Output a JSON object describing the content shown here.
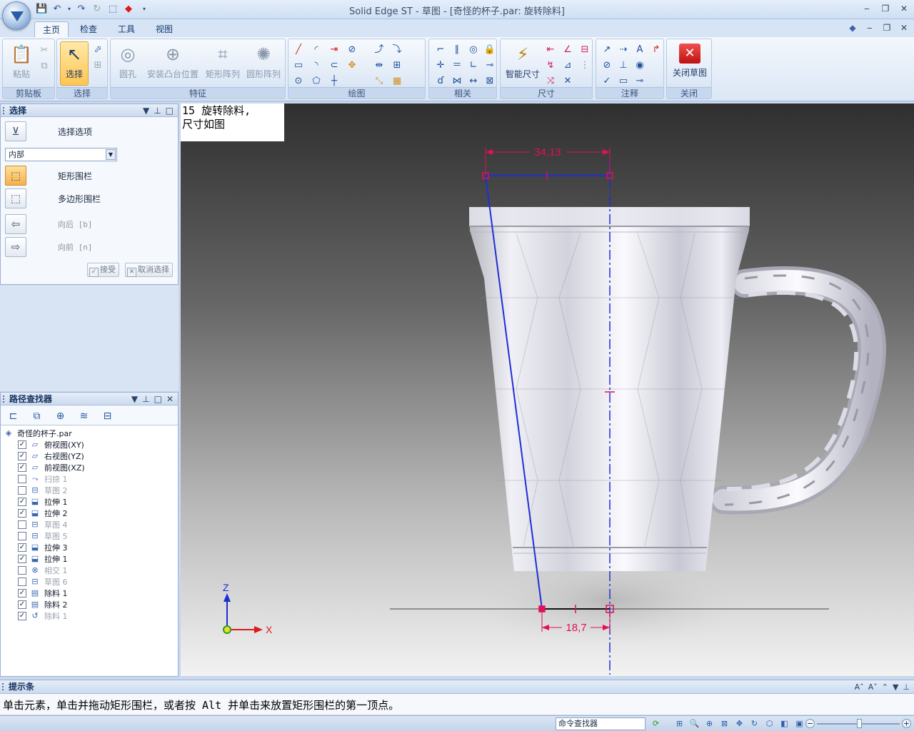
{
  "window": {
    "title": "Solid Edge ST - 草图 - [奇怪的杯子.par: 旋转除料]"
  },
  "tabs": [
    {
      "label": "主页",
      "active": true
    },
    {
      "label": "检查",
      "active": false
    },
    {
      "label": "工具",
      "active": false
    },
    {
      "label": "视图",
      "active": false
    }
  ],
  "ribbon": {
    "groups": {
      "clipboard": "剪贴板",
      "select": "选择",
      "feature": "特征",
      "draw": "绘图",
      "relate": "相关",
      "dimension": "尺寸",
      "annotation": "注释",
      "close": "关闭"
    },
    "buttons": {
      "paste": "粘贴",
      "select": "选择",
      "hole": "圆孔",
      "boss": "安装凸台位置",
      "rect_pattern": "矩形阵列",
      "circ_pattern": "圆形阵列",
      "smart_dim": "智能尺寸",
      "close_sketch": "关闭草图"
    }
  },
  "select_panel": {
    "title": "选择",
    "options_label": "选择选项",
    "mode_value": "内部",
    "rect_fence": "矩形围栏",
    "poly_fence": "多边形围栏",
    "back": "向后 [b]",
    "forward": "向前 [n]",
    "accept": "接受",
    "cancel": "取消选择"
  },
  "path_finder": {
    "title": "路径查找器",
    "root": "奇怪的杯子.par",
    "items": [
      {
        "label": "俯视图(XY)",
        "checked": true,
        "dim": false,
        "icon": "plane-icon"
      },
      {
        "label": "右视图(YZ)",
        "checked": true,
        "dim": false,
        "icon": "plane-icon"
      },
      {
        "label": "前视图(XZ)",
        "checked": true,
        "dim": false,
        "icon": "plane-icon"
      },
      {
        "label": "扫掠 1",
        "checked": false,
        "dim": true,
        "icon": "sweep-icon"
      },
      {
        "label": "草图 2",
        "checked": false,
        "dim": true,
        "icon": "sketch-icon"
      },
      {
        "label": "拉伸 1",
        "checked": true,
        "dim": false,
        "icon": "extrude-icon"
      },
      {
        "label": "拉伸 2",
        "checked": true,
        "dim": false,
        "icon": "extrude-icon"
      },
      {
        "label": "草图 4",
        "checked": false,
        "dim": true,
        "icon": "sketch-icon"
      },
      {
        "label": "草图 5",
        "checked": false,
        "dim": true,
        "icon": "sketch-icon"
      },
      {
        "label": "拉伸 3",
        "checked": true,
        "dim": false,
        "icon": "extrude-icon"
      },
      {
        "label": "拉伸 1",
        "checked": true,
        "dim": false,
        "icon": "extrude-icon"
      },
      {
        "label": "相交 1",
        "checked": false,
        "dim": true,
        "icon": "intersect-icon"
      },
      {
        "label": "草图 6",
        "checked": false,
        "dim": true,
        "icon": "sketch-icon"
      },
      {
        "label": "除料 1",
        "checked": true,
        "dim": false,
        "icon": "cutout-icon"
      },
      {
        "label": "除料 2",
        "checked": true,
        "dim": false,
        "icon": "cutout-icon"
      },
      {
        "label": "除料 1",
        "checked": true,
        "dim": true,
        "icon": "revolve-cut-icon"
      }
    ]
  },
  "viewport": {
    "note_line1": "15 旋转除料,",
    "note_line2": "尺寸如图",
    "dim_top": "34,13",
    "dim_bottom": "18,7",
    "axis_z": "Z",
    "axis_x": "X"
  },
  "prompt_bar": {
    "title": "提示条",
    "text": "单击元素，单击并拖动矩形围栏，或者按 Alt 并单击来放置矩形围栏的第一顶点。"
  },
  "status_bar": {
    "command_finder": "命令查找器"
  },
  "colors": {
    "sketch_line": "#1f2fd6",
    "dimension": "#e0105a",
    "ribbon_selected": "#ffc552"
  }
}
